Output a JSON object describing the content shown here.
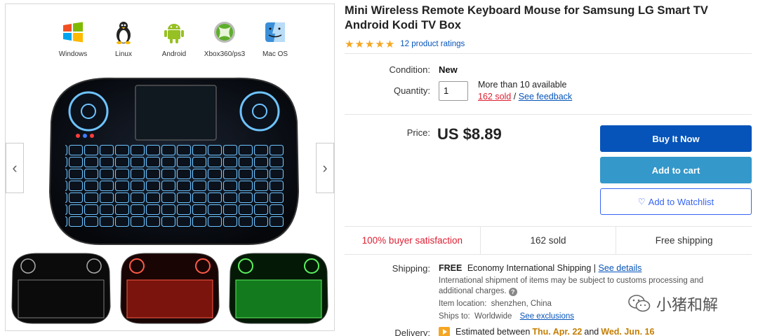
{
  "gallery": {
    "os_list": [
      {
        "label": "Windows",
        "icon": "windows-logo-icon"
      },
      {
        "label": "Linux",
        "icon": "linux-tux-icon"
      },
      {
        "label": "Android",
        "icon": "android-robot-icon"
      },
      {
        "label": "Xbox360/ps3",
        "icon": "xbox-logo-icon"
      },
      {
        "label": "Mac OS",
        "icon": "mac-finder-icon"
      }
    ],
    "prev_arrow": "‹",
    "next_arrow": "›",
    "thumbnail_colors": [
      "#0b0b0b",
      "#e53b2a",
      "#3bd43b"
    ]
  },
  "product": {
    "title": "Mini Wireless Remote Keyboard Mouse for Samsung LG Smart TV Android Kodi TV Box",
    "stars": "★★★★★",
    "ratings_text": "12 product ratings",
    "condition_label": "Condition:",
    "condition_value": "New",
    "quantity_label": "Quantity:",
    "quantity_value": "1",
    "availability": "More than 10 available",
    "sold_link": "162 sold",
    "sep": "/",
    "feedback_link": "See feedback",
    "price_label": "Price:",
    "price": "US $8.89"
  },
  "buttons": {
    "buy_now": "Buy It Now",
    "add_to_cart": "Add to cart",
    "watchlist": "Add to Watchlist"
  },
  "stats": {
    "satisfaction": "100% buyer satisfaction",
    "sold": "162 sold",
    "shipping": "Free shipping"
  },
  "shipping": {
    "label": "Shipping:",
    "free": "FREE",
    "method": "Economy International Shipping |",
    "see_details": "See details",
    "intl_note_1": "International shipment of items may be subject to customs processing and",
    "intl_note_2": "additional charges.",
    "location_label": "Item location:",
    "location_value": "shenzhen, China",
    "ships_to_label": "Ships to:",
    "ships_to_value": "Worldwide",
    "see_exclusions": "See exclusions"
  },
  "delivery": {
    "label": "Delivery:",
    "prefix": "Estimated between",
    "date_from": "Thu. Apr. 22",
    "and": "and",
    "date_to": "Wed. Jun. 16"
  },
  "watermark": {
    "text": "小猪和解"
  },
  "colors": {
    "primary_blue": "#0654ba",
    "cart_blue": "#3498ca",
    "star": "#f5a623",
    "red": "#dd1e31"
  }
}
